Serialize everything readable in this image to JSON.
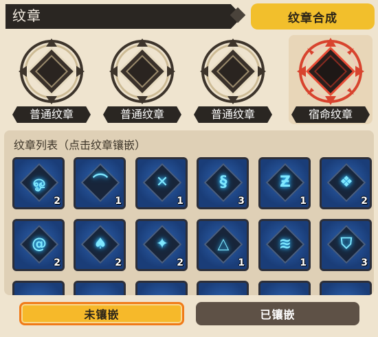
{
  "header": {
    "title": "纹章",
    "synth_label": "纹章合成"
  },
  "slots": [
    {
      "label": "普通纹章",
      "type": "normal"
    },
    {
      "label": "普通纹章",
      "type": "normal"
    },
    {
      "label": "普通纹章",
      "type": "normal"
    },
    {
      "label": "宿命纹章",
      "type": "fate",
      "selected": true
    }
  ],
  "list": {
    "title": "纹章列表（点击纹章镶嵌）",
    "items": [
      {
        "icon": "swirl-emblem-icon",
        "count": "2"
      },
      {
        "icon": "arch-emblem-icon",
        "count": "1"
      },
      {
        "icon": "cross-emblem-icon",
        "count": "1"
      },
      {
        "icon": "s-curve-emblem-icon",
        "count": "3"
      },
      {
        "icon": "z-rune-emblem-icon",
        "count": "1"
      },
      {
        "icon": "totem-emblem-icon",
        "count": "2"
      },
      {
        "icon": "spiral-emblem-icon",
        "count": "2"
      },
      {
        "icon": "flame-emblem-icon",
        "count": "2"
      },
      {
        "icon": "compass-emblem-icon",
        "count": "2"
      },
      {
        "icon": "triangle-emblem-icon",
        "count": "1"
      },
      {
        "icon": "wave-emblem-icon",
        "count": "1"
      },
      {
        "icon": "shield-emblem-icon",
        "count": "3"
      }
    ]
  },
  "tabs": {
    "unset_label": "未镶嵌",
    "set_label": "已镶嵌"
  },
  "colors": {
    "background": "#efe4cf",
    "accent": "#f2bf2c",
    "fate_red": "#d8432e",
    "glyph_cyan": "#7fe8ff"
  }
}
